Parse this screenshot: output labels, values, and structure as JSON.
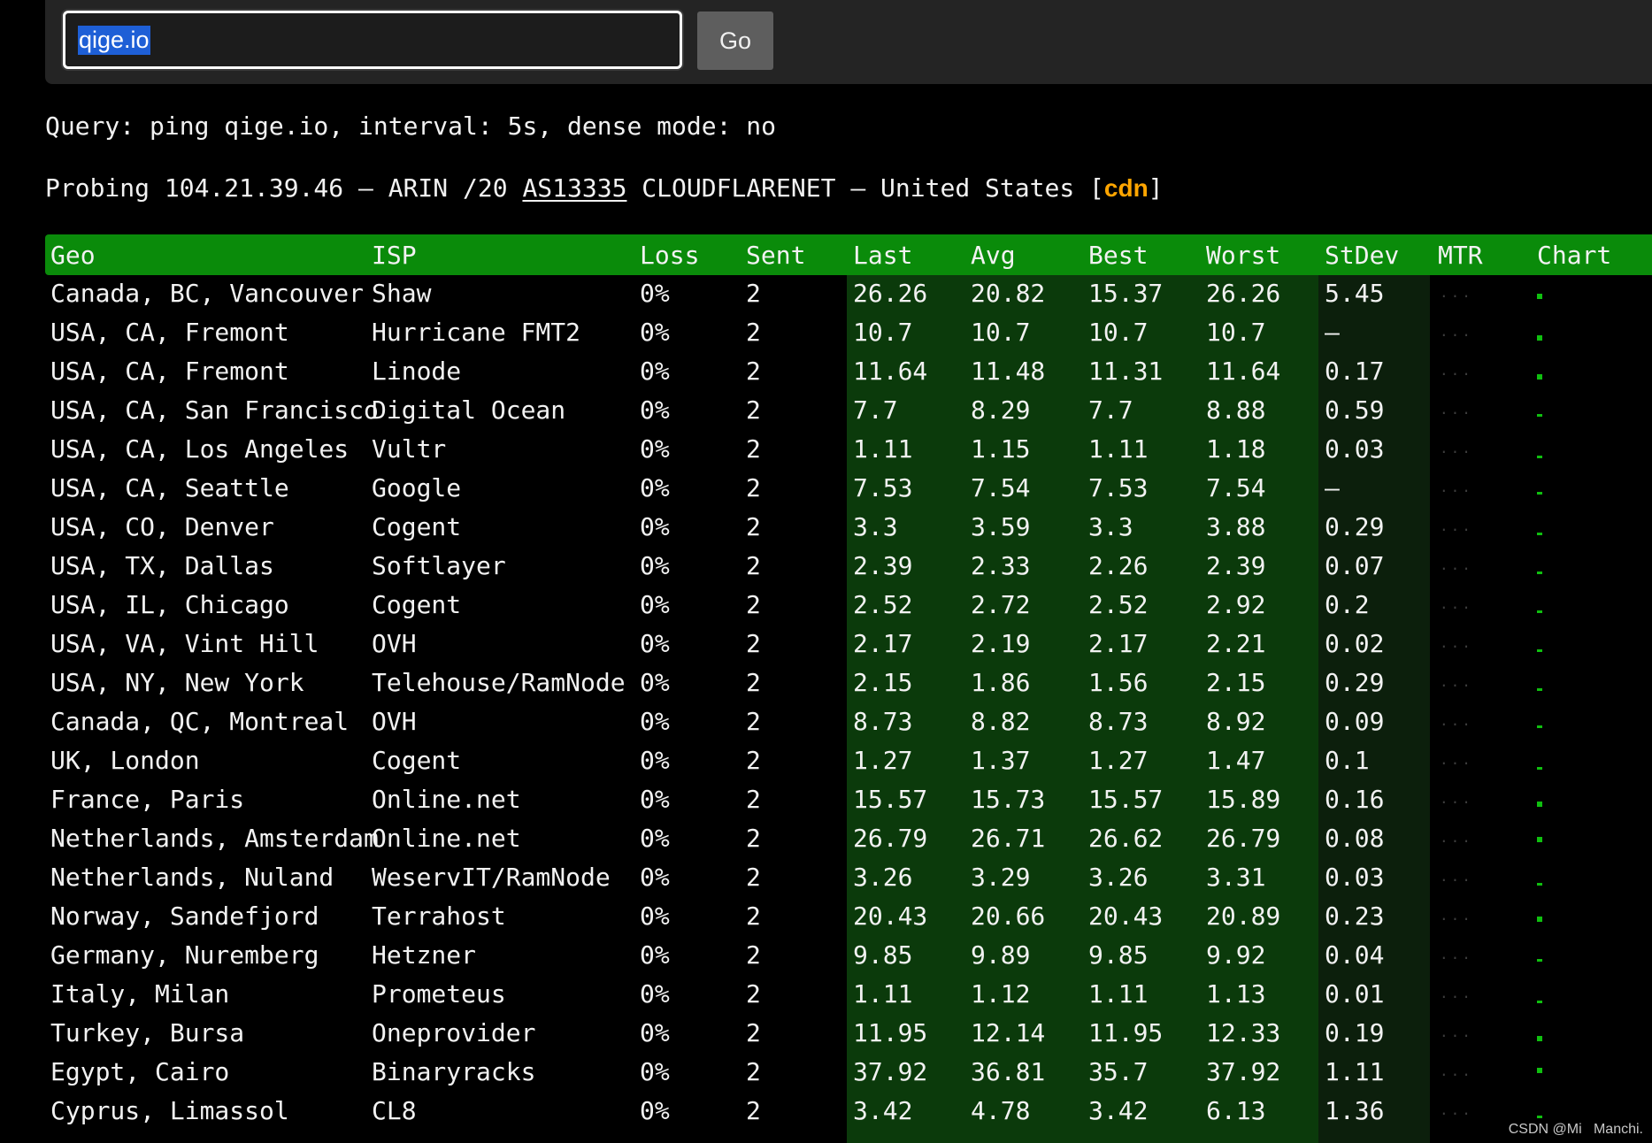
{
  "search": {
    "value": "qige.io",
    "button_label": "Go"
  },
  "query_line": "Query: ping qige.io, interval: 5s, dense mode: no",
  "probe": {
    "prefix": "Probing 104.21.39.46 — ARIN /20 ",
    "asn": "AS13335",
    "middle": " CLOUDFLARENET — United States [",
    "tag": "cdn",
    "suffix": "]"
  },
  "columns": [
    "Geo",
    "ISP",
    "Loss",
    "Sent",
    "Last",
    "Avg",
    "Best",
    "Worst",
    "StDev",
    "MTR",
    "Chart"
  ],
  "mtr_placeholder": "...",
  "rows": [
    {
      "geo": "Canada, BC, Vancouver",
      "isp": "Shaw",
      "loss": "0%",
      "sent": "2",
      "last": "26.26",
      "avg": "20.82",
      "best": "15.37",
      "worst": "26.26",
      "stdev": "5.45"
    },
    {
      "geo": "USA, CA, Fremont",
      "isp": "Hurricane FMT2",
      "loss": "0%",
      "sent": "2",
      "last": "10.7",
      "avg": "10.7",
      "best": "10.7",
      "worst": "10.7",
      "stdev": "—"
    },
    {
      "geo": "USA, CA, Fremont",
      "isp": "Linode",
      "loss": "0%",
      "sent": "2",
      "last": "11.64",
      "avg": "11.48",
      "best": "11.31",
      "worst": "11.64",
      "stdev": "0.17"
    },
    {
      "geo": "USA, CA, San Francisco",
      "isp": "Digital Ocean",
      "loss": "0%",
      "sent": "2",
      "last": "7.7",
      "avg": "8.29",
      "best": "7.7",
      "worst": "8.88",
      "stdev": "0.59"
    },
    {
      "geo": "USA, CA, Los Angeles",
      "isp": "Vultr",
      "loss": "0%",
      "sent": "2",
      "last": "1.11",
      "avg": "1.15",
      "best": "1.11",
      "worst": "1.18",
      "stdev": "0.03"
    },
    {
      "geo": "USA, CA, Seattle",
      "isp": "Google",
      "loss": "0%",
      "sent": "2",
      "last": "7.53",
      "avg": "7.54",
      "best": "7.53",
      "worst": "7.54",
      "stdev": "—"
    },
    {
      "geo": "USA, CO, Denver",
      "isp": "Cogent",
      "loss": "0%",
      "sent": "2",
      "last": "3.3",
      "avg": "3.59",
      "best": "3.3",
      "worst": "3.88",
      "stdev": "0.29"
    },
    {
      "geo": "USA, TX, Dallas",
      "isp": "Softlayer",
      "loss": "0%",
      "sent": "2",
      "last": "2.39",
      "avg": "2.33",
      "best": "2.26",
      "worst": "2.39",
      "stdev": "0.07"
    },
    {
      "geo": "USA, IL, Chicago",
      "isp": "Cogent",
      "loss": "0%",
      "sent": "2",
      "last": "2.52",
      "avg": "2.72",
      "best": "2.52",
      "worst": "2.92",
      "stdev": "0.2"
    },
    {
      "geo": "USA, VA, Vint Hill",
      "isp": "OVH",
      "loss": "0%",
      "sent": "2",
      "last": "2.17",
      "avg": "2.19",
      "best": "2.17",
      "worst": "2.21",
      "stdev": "0.02"
    },
    {
      "geo": "USA, NY, New York",
      "isp": "Telehouse/RamNode",
      "loss": "0%",
      "sent": "2",
      "last": "2.15",
      "avg": "1.86",
      "best": "1.56",
      "worst": "2.15",
      "stdev": "0.29"
    },
    {
      "geo": "Canada, QC, Montreal",
      "isp": "OVH",
      "loss": "0%",
      "sent": "2",
      "last": "8.73",
      "avg": "8.82",
      "best": "8.73",
      "worst": "8.92",
      "stdev": "0.09"
    },
    {
      "geo": "UK, London",
      "isp": "Cogent",
      "loss": "0%",
      "sent": "2",
      "last": "1.27",
      "avg": "1.37",
      "best": "1.27",
      "worst": "1.47",
      "stdev": "0.1"
    },
    {
      "geo": "France, Paris",
      "isp": "Online.net",
      "loss": "0%",
      "sent": "2",
      "last": "15.57",
      "avg": "15.73",
      "best": "15.57",
      "worst": "15.89",
      "stdev": "0.16"
    },
    {
      "geo": "Netherlands, Amsterdam",
      "isp": "Online.net",
      "loss": "0%",
      "sent": "2",
      "last": "26.79",
      "avg": "26.71",
      "best": "26.62",
      "worst": "26.79",
      "stdev": "0.08"
    },
    {
      "geo": "Netherlands, Nuland",
      "isp": "WeservIT/RamNode",
      "loss": "0%",
      "sent": "2",
      "last": "3.26",
      "avg": "3.29",
      "best": "3.26",
      "worst": "3.31",
      "stdev": "0.03"
    },
    {
      "geo": "Norway, Sandefjord",
      "isp": "Terrahost",
      "loss": "0%",
      "sent": "2",
      "last": "20.43",
      "avg": "20.66",
      "best": "20.43",
      "worst": "20.89",
      "stdev": "0.23"
    },
    {
      "geo": "Germany, Nuremberg",
      "isp": "Hetzner",
      "loss": "0%",
      "sent": "2",
      "last": "9.85",
      "avg": "9.89",
      "best": "9.85",
      "worst": "9.92",
      "stdev": "0.04"
    },
    {
      "geo": "Italy, Milan",
      "isp": "Prometeus",
      "loss": "0%",
      "sent": "2",
      "last": "1.11",
      "avg": "1.12",
      "best": "1.11",
      "worst": "1.13",
      "stdev": "0.01"
    },
    {
      "geo": "Turkey, Bursa",
      "isp": "Oneprovider",
      "loss": "0%",
      "sent": "2",
      "last": "11.95",
      "avg": "12.14",
      "best": "11.95",
      "worst": "12.33",
      "stdev": "0.19"
    },
    {
      "geo": "Egypt, Cairo",
      "isp": "Binaryracks",
      "loss": "0%",
      "sent": "2",
      "last": "37.92",
      "avg": "36.81",
      "best": "35.7",
      "worst": "37.92",
      "stdev": "1.11"
    },
    {
      "geo": "Cyprus, Limassol",
      "isp": "CL8",
      "loss": "0%",
      "sent": "2",
      "last": "3.42",
      "avg": "4.78",
      "best": "3.42",
      "worst": "6.13",
      "stdev": "1.36"
    }
  ],
  "colors": {
    "header_bg": "#0a8b0a",
    "metrics_band": "#0b3a0b",
    "chart_mark": "#0fbf0f",
    "cdn_tag": "#ffa500",
    "selection": "#1e5fd6"
  },
  "watermark": "CSDN @Mi   Manchi."
}
